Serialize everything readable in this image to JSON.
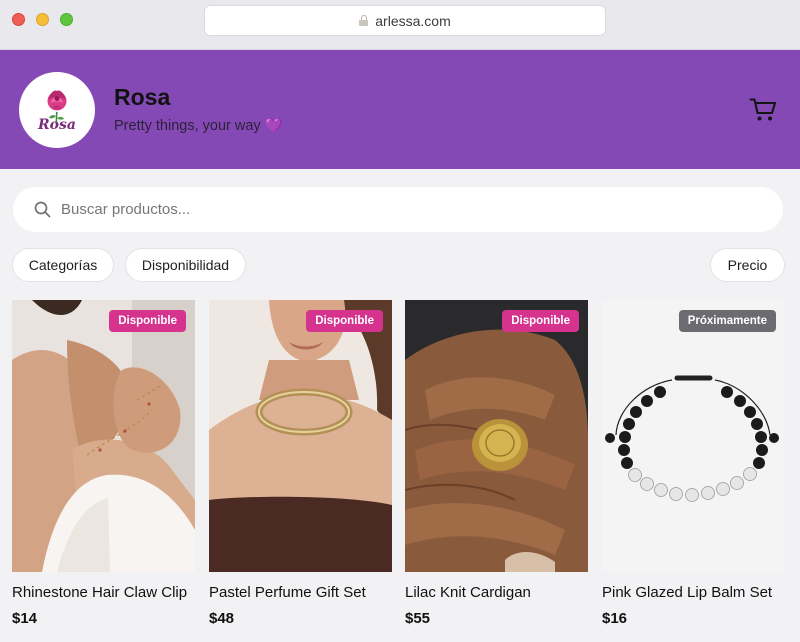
{
  "browser": {
    "url": "arlessa.com"
  },
  "store": {
    "logo_text": "Rosa",
    "name": "Rosa",
    "tagline": "Pretty things, your way 💜"
  },
  "search": {
    "placeholder": "Buscar productos..."
  },
  "filters": {
    "categories": "Categorías",
    "availability": "Disponibilidad",
    "price": "Precio"
  },
  "products": [
    {
      "name": "Rhinestone Hair Claw Clip",
      "price": "$14",
      "badge": "Disponible",
      "badge_color": "#d6338f"
    },
    {
      "name": "Pastel Perfume Gift Set",
      "price": "$48",
      "badge": "Disponible",
      "badge_color": "#d6338f"
    },
    {
      "name": "Lilac Knit Cardigan",
      "price": "$55",
      "badge": "Disponible",
      "badge_color": "#d6338f"
    },
    {
      "name": "Pink Glazed Lip Balm Set",
      "price": "$16",
      "badge": "Próximamente",
      "badge_color": "#6b6b70"
    }
  ],
  "colors": {
    "header": "#8549b6",
    "badge_available": "#d6338f",
    "badge_soon": "#6b6b70"
  }
}
